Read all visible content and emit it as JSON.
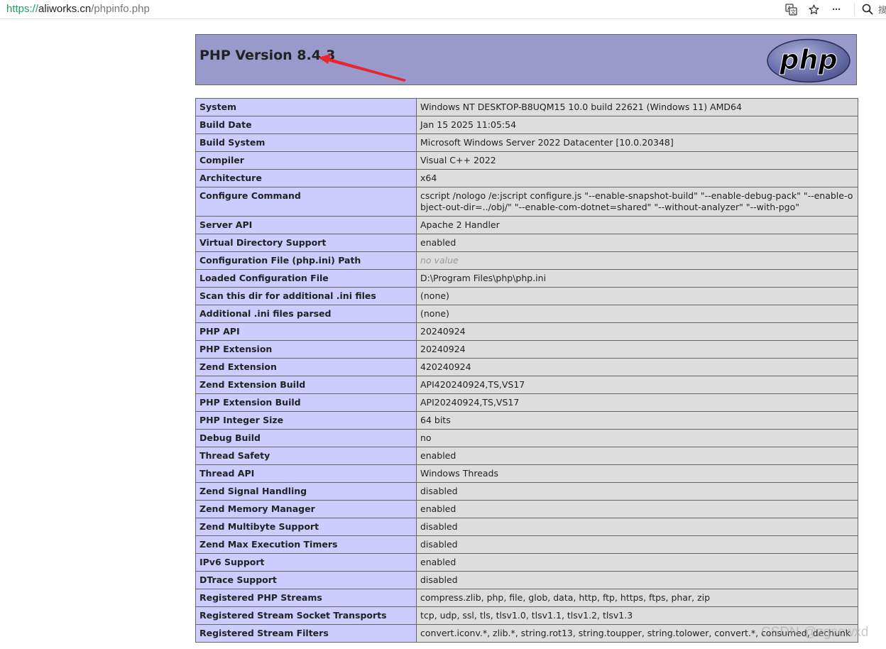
{
  "browser": {
    "url_scheme": "https://",
    "url_host": "aliworks.cn",
    "url_path": "/phpinfo.php",
    "icons": [
      "translate-icon",
      "star-icon",
      "more-icon",
      "search-icon"
    ],
    "more_glyph": "···",
    "search_label": "搜"
  },
  "header": {
    "title": "PHP Version 8.4.3",
    "logo_text": "php"
  },
  "rows": [
    {
      "key": "System",
      "value": "Windows NT DESKTOP-B8UQM15 10.0 build 22621 (Windows 11) AMD64"
    },
    {
      "key": "Build Date",
      "value": "Jan 15 2025 11:05:54"
    },
    {
      "key": "Build System",
      "value": "Microsoft Windows Server 2022 Datacenter [10.0.20348]"
    },
    {
      "key": "Compiler",
      "value": "Visual C++ 2022"
    },
    {
      "key": "Architecture",
      "value": "x64"
    },
    {
      "key": "Configure Command",
      "value": "cscript /nologo /e:jscript configure.js \"--enable-snapshot-build\" \"--enable-debug-pack\" \"--enable-object-out-dir=../obj/\" \"--enable-com-dotnet=shared\" \"--without-analyzer\" \"--with-pgo\""
    },
    {
      "key": "Server API",
      "value": "Apache 2 Handler"
    },
    {
      "key": "Virtual Directory Support",
      "value": "enabled"
    },
    {
      "key": "Configuration File (php.ini) Path",
      "value": "no value",
      "novalue": true
    },
    {
      "key": "Loaded Configuration File",
      "value": "D:\\Program Files\\php\\php.ini"
    },
    {
      "key": "Scan this dir for additional .ini files",
      "value": "(none)"
    },
    {
      "key": "Additional .ini files parsed",
      "value": "(none)"
    },
    {
      "key": "PHP API",
      "value": "20240924"
    },
    {
      "key": "PHP Extension",
      "value": "20240924"
    },
    {
      "key": "Zend Extension",
      "value": "420240924"
    },
    {
      "key": "Zend Extension Build",
      "value": "API420240924,TS,VS17"
    },
    {
      "key": "PHP Extension Build",
      "value": "API20240924,TS,VS17"
    },
    {
      "key": "PHP Integer Size",
      "value": "64 bits"
    },
    {
      "key": "Debug Build",
      "value": "no"
    },
    {
      "key": "Thread Safety",
      "value": "enabled"
    },
    {
      "key": "Thread API",
      "value": "Windows Threads"
    },
    {
      "key": "Zend Signal Handling",
      "value": "disabled"
    },
    {
      "key": "Zend Memory Manager",
      "value": "enabled"
    },
    {
      "key": "Zend Multibyte Support",
      "value": "disabled"
    },
    {
      "key": "Zend Max Execution Timers",
      "value": "disabled"
    },
    {
      "key": "IPv6 Support",
      "value": "enabled"
    },
    {
      "key": "DTrace Support",
      "value": "disabled"
    },
    {
      "key": "Registered PHP Streams",
      "value": "compress.zlib, php, file, glob, data, http, ftp, https, ftps, phar, zip"
    },
    {
      "key": "Registered Stream Socket Transports",
      "value": "tcp, udp, ssl, tls, tlsv1.0, tlsv1.1, tlsv1.2, tlsv1.3"
    },
    {
      "key": "Registered Stream Filters",
      "value": "convert.iconv.*, zlib.*, string.rot13, string.toupper, string.tolower, convert.*, consumed, dechunk"
    }
  ],
  "watermark": "CSDN @zgscwxd",
  "colors": {
    "header_bg": "#9999cc",
    "key_bg": "#ccccff",
    "value_bg": "#dddddd",
    "border": "#666666",
    "arrow": "#e8262b"
  }
}
